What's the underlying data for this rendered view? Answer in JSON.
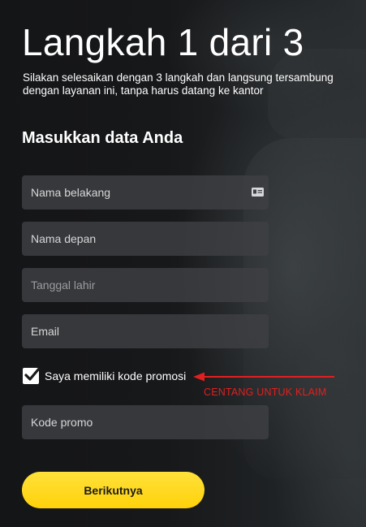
{
  "header": {
    "title": "Langkah 1 dari 3",
    "subtitle": "Silakan selesaikan dengan 3 langkah dan langsung tersambung dengan layanan ini, tanpa harus datang ke kantor"
  },
  "form": {
    "section_title": "Masukkan data Anda",
    "fields": [
      {
        "placeholder": "Nama belakang",
        "icon": "id-card-icon"
      },
      {
        "placeholder": "Nama depan"
      },
      {
        "placeholder": "Tanggal lahir"
      },
      {
        "placeholder": "Email"
      }
    ],
    "promo_checkbox": {
      "label": "Saya memiliki kode promosi",
      "checked": true
    },
    "promo_field": {
      "placeholder": "Kode promo"
    },
    "next_button": "Berikutnya"
  },
  "annotation": {
    "text": "CENTANG UNTUK KLAIM",
    "color": "#e0201f"
  },
  "colors": {
    "accent": "#ffd20a",
    "field_bg": "#3e4043"
  }
}
